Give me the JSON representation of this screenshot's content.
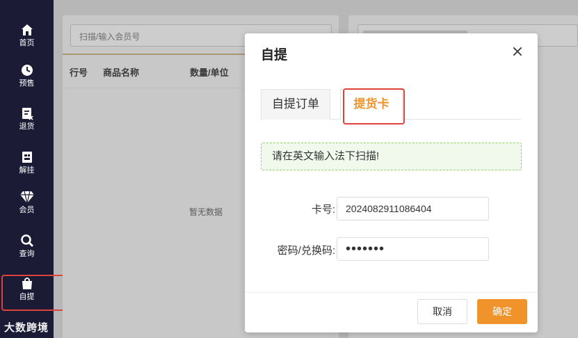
{
  "sidebar": {
    "items": [
      {
        "label": "首页",
        "icon": "home-icon"
      },
      {
        "label": "预售",
        "icon": "clock-icon"
      },
      {
        "label": "退货",
        "icon": "return-doc-icon"
      },
      {
        "label": "解挂",
        "icon": "unhang-icon"
      },
      {
        "label": "会员",
        "icon": "diamond-icon"
      },
      {
        "label": "查询",
        "icon": "search-icon"
      },
      {
        "label": "自提",
        "icon": "shopping-bag-icon"
      }
    ],
    "active_index": 6
  },
  "background": {
    "search_placeholder": "扫描/输入会员号",
    "columns": [
      "行号",
      "商品名称",
      "数量/单位"
    ],
    "empty_text": "暂无数据"
  },
  "modal": {
    "title": "自提",
    "tabs": [
      {
        "label": "自提订单"
      },
      {
        "label": "提货卡"
      }
    ],
    "active_tab": 1,
    "notice": "请在英文输入法下扫描!",
    "fields": {
      "card_label": "卡号:",
      "card_value": "2024082911086404",
      "password_label": "密码/兑换码:",
      "password_value": "•••••••"
    },
    "buttons": {
      "cancel": "取消",
      "ok": "确定"
    }
  },
  "watermark": "大数跨境",
  "colors": {
    "accent": "#f0932b",
    "sidebar_bg": "#1b1b36",
    "highlight": "#e0413b",
    "notice_bg": "#f0f9eb",
    "notice_border": "#8fd468"
  }
}
